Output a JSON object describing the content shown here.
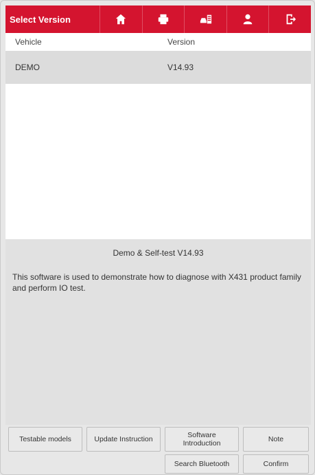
{
  "titlebar": {
    "title": "Select Version",
    "icons": [
      "home-icon",
      "printer-icon",
      "vehicle-list-icon",
      "user-icon",
      "exit-icon"
    ]
  },
  "table": {
    "headers": [
      "Vehicle",
      "Version"
    ],
    "rows": [
      {
        "vehicle": "DEMO",
        "version": "V14.93"
      }
    ]
  },
  "description": {
    "title": "Demo & Self-test V14.93",
    "body": "This software is used to demonstrate how to diagnose with X431 product family and perform IO test."
  },
  "buttons": {
    "testable_models": "Testable models",
    "update_instruction": "Update Instruction",
    "software_introduction": "Software Introduction",
    "note": "Note",
    "search_bluetooth": "Search Bluetooth",
    "confirm": "Confirm"
  },
  "colors": {
    "titlebar": "#d4142f",
    "selected_row": "#dcdcdc",
    "background": "#e7e7e7"
  }
}
